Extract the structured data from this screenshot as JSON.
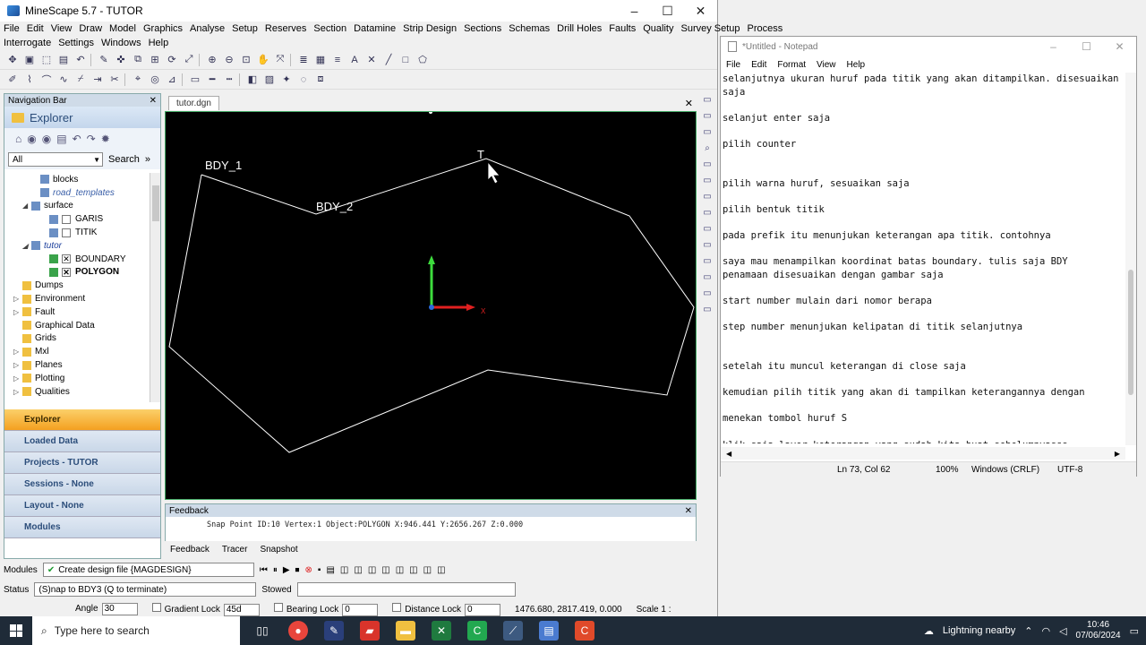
{
  "minescape": {
    "title": "MineScape 5.7 - TUTOR",
    "menu_row1": [
      "File",
      "Edit",
      "View",
      "Draw",
      "Model",
      "Graphics",
      "Analyse",
      "Setup",
      "Reserves",
      "Section",
      "Datamine",
      "Strip Design",
      "Sections",
      "Schemas",
      "Drill Holes",
      "Faults",
      "Quality",
      "Survey Setup",
      "Process"
    ],
    "menu_row2": [
      "Interrogate",
      "Settings",
      "Windows",
      "Help"
    ],
    "nav": {
      "header": "Navigation Bar",
      "title": "Explorer",
      "filter_value": "All",
      "search_label": "Search",
      "tree": [
        {
          "label": "blocks",
          "indent": 3,
          "icon": "l",
          "style": ""
        },
        {
          "label": "road_templates",
          "indent": 3,
          "icon": "l",
          "style": "it"
        },
        {
          "label": "surface",
          "indent": 2,
          "icon": "l",
          "style": "",
          "toggle": "◢"
        },
        {
          "label": "GARIS",
          "indent": 4,
          "icon": "l",
          "style": "",
          "check": " "
        },
        {
          "label": "TITIK",
          "indent": 4,
          "icon": "l",
          "style": "",
          "check": " "
        },
        {
          "label": "tutor",
          "indent": 2,
          "icon": "l",
          "style": "it blue",
          "toggle": "◢"
        },
        {
          "label": "BOUNDARY",
          "indent": 4,
          "icon": "g",
          "style": "",
          "check": "✕"
        },
        {
          "label": "POLYGON",
          "indent": 4,
          "icon": "g",
          "style": "bold",
          "check": "✕"
        },
        {
          "label": "Dumps",
          "indent": 1,
          "icon": "f",
          "style": ""
        },
        {
          "label": "Environment",
          "indent": 1,
          "icon": "f",
          "style": "",
          "toggle": "▷"
        },
        {
          "label": "Fault",
          "indent": 1,
          "icon": "f",
          "style": "",
          "toggle": "▷"
        },
        {
          "label": "Graphical Data",
          "indent": 1,
          "icon": "f",
          "style": ""
        },
        {
          "label": "Grids",
          "indent": 1,
          "icon": "f",
          "style": ""
        },
        {
          "label": "Mxl",
          "indent": 1,
          "icon": "f",
          "style": "",
          "toggle": "▷"
        },
        {
          "label": "Planes",
          "indent": 1,
          "icon": "f",
          "style": "",
          "toggle": "▷"
        },
        {
          "label": "Plotting",
          "indent": 1,
          "icon": "f",
          "style": "",
          "toggle": "▷"
        },
        {
          "label": "Qualities",
          "indent": 1,
          "icon": "f",
          "style": "",
          "toggle": "▷"
        }
      ],
      "sections": [
        "Explorer",
        "Loaded Data",
        "Projects - TUTOR",
        "Sessions - None",
        "Layout - None",
        "Modules"
      ]
    },
    "doc_tab": "tutor.dgn",
    "labels": {
      "bdy1": "BDY_1",
      "bdy2": "BDY_2",
      "t": "T",
      "axis_y": "Y",
      "axis_x": "X"
    },
    "feedback": {
      "header": "Feedback",
      "line": "Snap Point ID:10 Vertex:1 Object:POLYGON X:946.441 Y:2656.267 Z:0.000",
      "tabs": [
        "Feedback",
        "Tracer",
        "Snapshot"
      ]
    },
    "modules_label": "Modules",
    "modules_value": "Create design file {MAGDESIGN}",
    "status_label": "Status",
    "status_value": "(S)nap to BDY3 (Q to terminate)",
    "stowed_label": "Stowed",
    "angle_label": "Angle",
    "angle_value": "30",
    "gradient_label": "Gradient Lock",
    "gradient_value": "45d",
    "bearing_label": "Bearing Lock",
    "bearing_value": "0",
    "distance_label": "Distance Lock",
    "distance_value": "0",
    "coords": "1476.680, 2817.419, 0.000",
    "scale": "Scale 1 :"
  },
  "notepad": {
    "title": "*Untitled - Notepad",
    "menu": [
      "File",
      "Edit",
      "Format",
      "View",
      "Help"
    ],
    "text": "selanjutnya ukuran huruf pada titik yang akan ditampilkan. disesuaikan\nsaja\n\nselanjut enter saja\n\npilih counter\n\n\npilih warna huruf, sesuaikan saja\n\npilih bentuk titik\n\npada prefik itu menunjukan keterangan apa titik. contohnya\n\nsaya mau menampilkan koordinat batas boundary. tulis saja BDY\npenamaan disesuaikan dengan gambar saja\n\nstart number mulain dari nomor berapa\n\nstep number menunjukan kelipatan di titik selanjutnya\n\n\nsetelah itu muncul keterangan di close saja\n\nkemudian pilih titik yang akan di tampilkan keterangannya dengan\n\nmenekan tombol huruf S\n\nklik saja layer keterangan yang sudah kita buat sebelumnyasss",
    "status": {
      "position": "Ln 73, Col 62",
      "zoom": "100%",
      "eol": "Windows (CRLF)",
      "encoding": "UTF-8"
    }
  },
  "taskbar": {
    "search_placeholder": "Type here to search",
    "weather": "Lightning nearby",
    "time": "10:46",
    "date": "07/06/2024"
  }
}
